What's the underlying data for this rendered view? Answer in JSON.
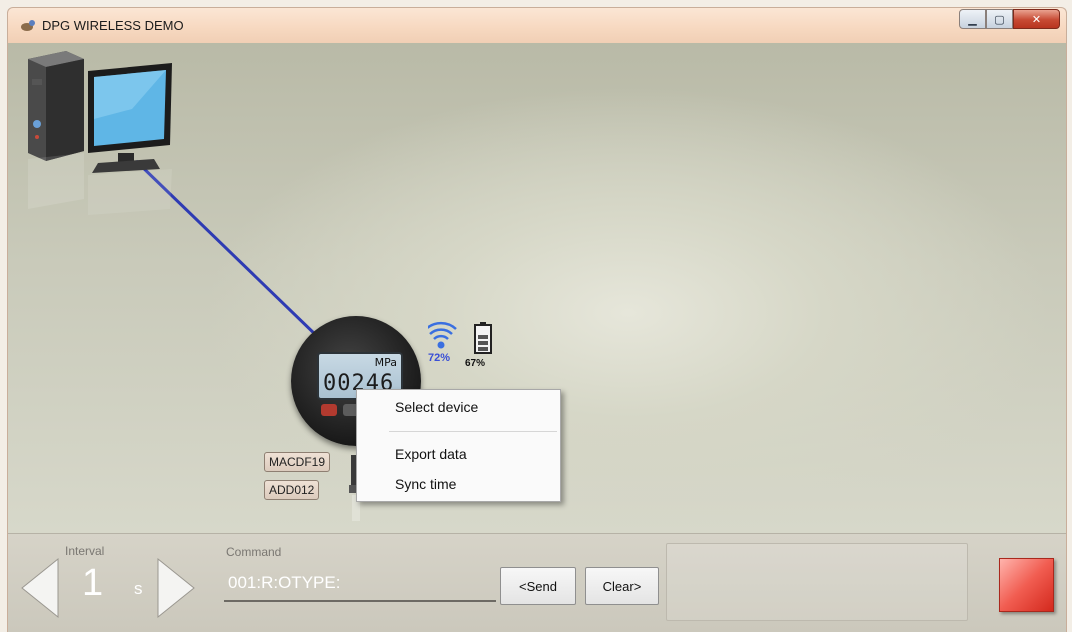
{
  "window": {
    "title": "DPG WIRELESS DEMO",
    "controls": {
      "minimize": "minimize-icon",
      "maximize": "maximize-icon",
      "close": "close-icon"
    }
  },
  "device": {
    "unit": "MPa",
    "reading": "00246",
    "signal_strength": "72%",
    "battery_level": "67%",
    "mac_address": "MACDF19",
    "address": "ADD012"
  },
  "context_menu": {
    "items": [
      "Select device",
      "Export data",
      "Sync time"
    ]
  },
  "controls": {
    "interval_label": "Interval",
    "interval_value": "1",
    "interval_unit": "s",
    "command_label": "Command",
    "command_value": "001:R:OTYPE:",
    "send_label": "<Send",
    "clear_label": "Clear>",
    "response_text": ""
  },
  "colors": {
    "connection_line": "#2e3bb3",
    "stop_button": "#e8473b",
    "signal": "#3a4fd6"
  }
}
